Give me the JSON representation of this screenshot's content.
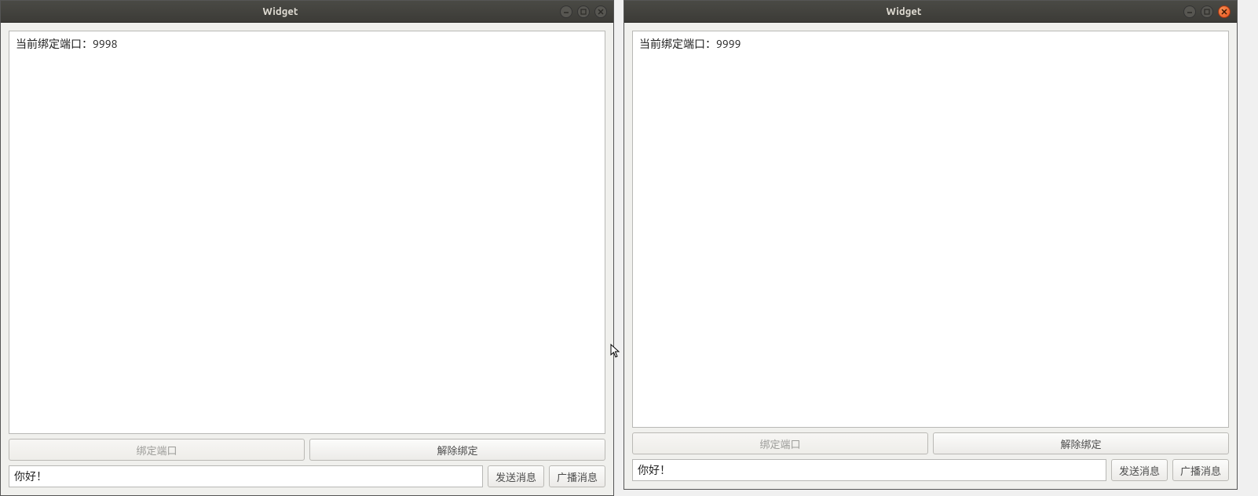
{
  "windows": [
    {
      "title": "Widget",
      "close_orange": false,
      "log_text": "当前绑定端口：9998",
      "bind_label": "绑定端口",
      "unbind_label": "解除绑定",
      "bind_disabled": true,
      "input_value": "你好！",
      "send_label": "发送消息",
      "broadcast_label": "广播消息"
    },
    {
      "title": "Widget",
      "close_orange": true,
      "log_text": "当前绑定端口：9999",
      "bind_label": "绑定端口",
      "unbind_label": "解除绑定",
      "bind_disabled": true,
      "input_value": "你好！",
      "send_label": "发送消息",
      "broadcast_label": "广播消息"
    }
  ]
}
